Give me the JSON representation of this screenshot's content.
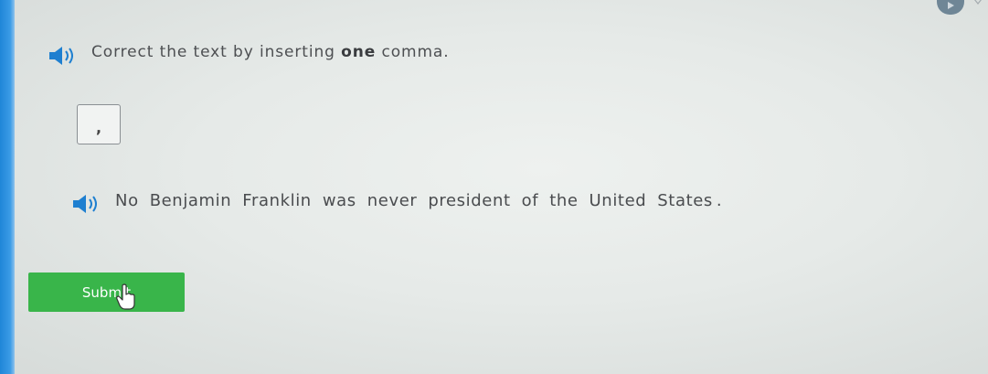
{
  "instruction": {
    "text_before": "Correct the text by inserting ",
    "emphasis": "one",
    "text_after": " comma."
  },
  "tile": {
    "label": ","
  },
  "sentence": {
    "words": [
      "No",
      "Benjamin",
      "Franklin",
      "was",
      "never",
      "president",
      "of",
      "the",
      "United",
      "States",
      "."
    ]
  },
  "submit": {
    "label": "Submit"
  },
  "icons": {
    "speaker": "speaker-icon",
    "cursor": "hand-cursor-icon"
  },
  "colors": {
    "accent_blue": "#1f86d8",
    "submit_green": "#39b54a"
  }
}
